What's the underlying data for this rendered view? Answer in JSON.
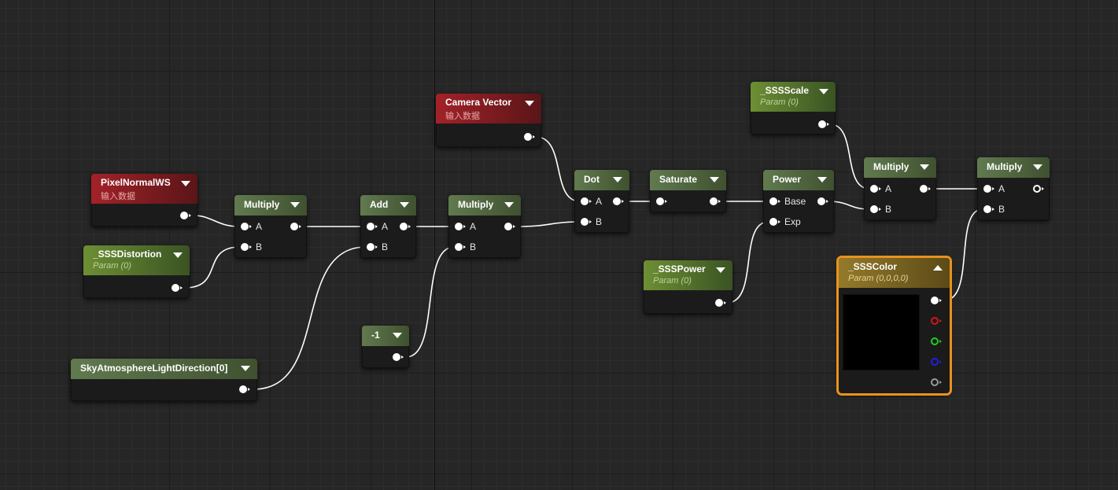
{
  "colors": {
    "grid_bg": "#262626",
    "wire": "#ffffff",
    "selected_outline": "#e8921f"
  },
  "nodes": {
    "pixel_normal_ws": {
      "title": "PixelNormalWS",
      "subtitle": "输入数据"
    },
    "sss_distortion": {
      "title": "_SSSDistortion",
      "subtitle": "Param (0)"
    },
    "sky_light_dir": {
      "title": "SkyAtmosphereLightDirection[0]"
    },
    "multiply_1": {
      "title": "Multiply",
      "pins": [
        "A",
        "B"
      ]
    },
    "add": {
      "title": "Add",
      "pins": [
        "A",
        "B"
      ]
    },
    "constant_neg1": {
      "title": "-1"
    },
    "multiply_2": {
      "title": "Multiply",
      "pins": [
        "A",
        "B"
      ]
    },
    "camera_vector": {
      "title": "Camera Vector",
      "subtitle": "输入数据"
    },
    "dot": {
      "title": "Dot",
      "pins": [
        "A",
        "B"
      ]
    },
    "saturate": {
      "title": "Saturate"
    },
    "power": {
      "title": "Power",
      "pins": [
        "Base",
        "Exp"
      ]
    },
    "sss_power": {
      "title": "_SSSPower",
      "subtitle": "Param (0)"
    },
    "sss_scale": {
      "title": "_SSSScale",
      "subtitle": "Param (0)"
    },
    "multiply_3": {
      "title": "Multiply",
      "pins": [
        "A",
        "B"
      ]
    },
    "multiply_4": {
      "title": "Multiply",
      "pins": [
        "A",
        "B"
      ]
    },
    "sss_color": {
      "title": "_SSSColor",
      "subtitle": "Param (0,0,0,0)",
      "output_channels": [
        "rgb",
        "r",
        "g",
        "b",
        "a"
      ]
    }
  },
  "connections": [
    {
      "from": "pixel_normal_ws",
      "to": "multiply_1.A"
    },
    {
      "from": "sss_distortion",
      "to": "multiply_1.B"
    },
    {
      "from": "multiply_1",
      "to": "add.A"
    },
    {
      "from": "sky_light_dir",
      "to": "add.B"
    },
    {
      "from": "add",
      "to": "multiply_2.A"
    },
    {
      "from": "constant_neg1",
      "to": "multiply_2.B"
    },
    {
      "from": "camera_vector",
      "to": "dot.A"
    },
    {
      "from": "multiply_2",
      "to": "dot.B"
    },
    {
      "from": "dot",
      "to": "saturate"
    },
    {
      "from": "saturate",
      "to": "power.Base"
    },
    {
      "from": "sss_power",
      "to": "power.Exp"
    },
    {
      "from": "sss_scale",
      "to": "multiply_3.A"
    },
    {
      "from": "power",
      "to": "multiply_3.B"
    },
    {
      "from": "multiply_3",
      "to": "multiply_4.A"
    },
    {
      "from": "sss_color",
      "to": "multiply_4.B"
    }
  ]
}
